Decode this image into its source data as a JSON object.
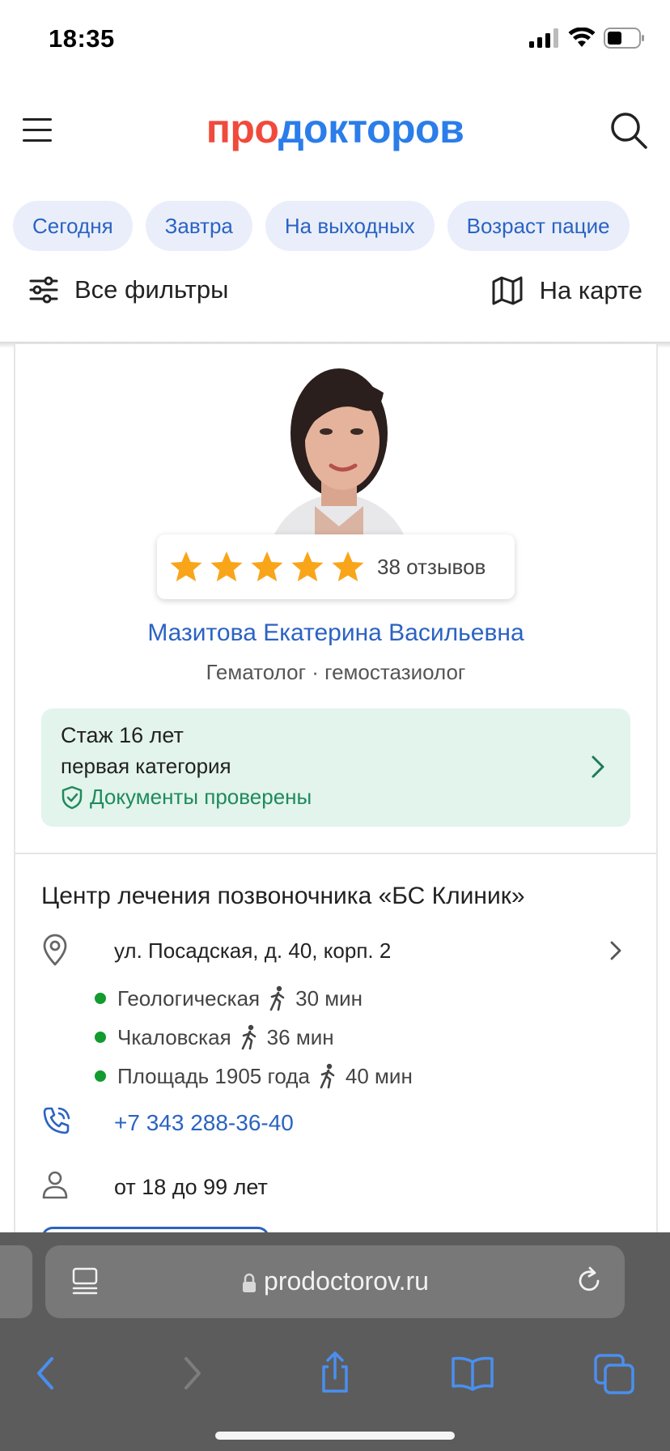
{
  "status_bar": {
    "time": "18:35"
  },
  "header": {
    "logo_part1": "про",
    "logo_part2": "докторов"
  },
  "chips": [
    "Сегодня",
    "Завтра",
    "На выходных",
    "Возраст пацие"
  ],
  "filters": {
    "all_filters": "Все фильтры",
    "on_map": "На карте"
  },
  "doctor": {
    "reviews": "38 отзывов",
    "rating_stars": 5,
    "name": "Мазитова Екатерина Васильевна",
    "specialty": "Гематолог · гемостазиолог",
    "experience": "Стаж 16 лет",
    "category": "первая категория",
    "documents": "Документы проверены"
  },
  "clinic": {
    "name": "Центр лечения позвоночника «БС Клиник»",
    "address": "ул. Посадская, д. 40, корп. 2",
    "metro": [
      {
        "station": "Геологическая",
        "time": "30 мин"
      },
      {
        "station": "Чкаловская",
        "time": "36 мин"
      },
      {
        "station": "Площадь 1905 года",
        "time": "40 мин"
      }
    ],
    "phone": "+7 343 288-36-40",
    "age": "от 18 до 99 лет"
  },
  "browser": {
    "url": "prodoctorov.ru"
  },
  "colors": {
    "brand_red": "#f04a3c",
    "brand_blue": "#2b7de9",
    "link_blue": "#2b63c2",
    "success_green": "#1f8a5c",
    "metro_green": "#129b2e",
    "star": "#f9a51a"
  }
}
